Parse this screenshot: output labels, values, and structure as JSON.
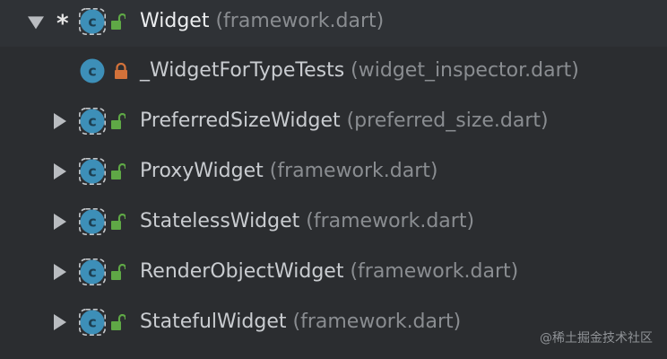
{
  "tree": {
    "rows": [
      {
        "name": "Widget",
        "file": " (framework.dart)",
        "expanded": true,
        "marker": "*",
        "icon": "class-icon",
        "visibility": "public-unlocked-icon",
        "selected": true
      },
      {
        "name": "_WidgetForTypeTests",
        "file": " (widget_inspector.dart)",
        "expanded": null,
        "icon": "class-icon",
        "visibility": "private-lock-icon"
      },
      {
        "name": "PreferredSizeWidget",
        "file": " (preferred_size.dart)",
        "expanded": false,
        "icon": "class-icon",
        "visibility": "public-unlocked-icon"
      },
      {
        "name": "ProxyWidget",
        "file": " (framework.dart)",
        "expanded": false,
        "icon": "class-icon",
        "visibility": "public-unlocked-icon"
      },
      {
        "name": "StatelessWidget",
        "file": " (framework.dart)",
        "expanded": false,
        "icon": "class-icon",
        "visibility": "public-unlocked-icon"
      },
      {
        "name": "RenderObjectWidget",
        "file": " (framework.dart)",
        "expanded": false,
        "icon": "class-icon",
        "visibility": "public-unlocked-icon"
      },
      {
        "name": "StatefulWidget",
        "file": " (framework.dart)",
        "expanded": false,
        "icon": "class-icon",
        "visibility": "public-unlocked-icon"
      }
    ]
  },
  "watermark": "@稀土掘金技术社区",
  "colors": {
    "background": "#2b2d30",
    "class_icon": "#3d8fb8",
    "unlocked": "#5fa846",
    "locked": "#d3723a"
  }
}
